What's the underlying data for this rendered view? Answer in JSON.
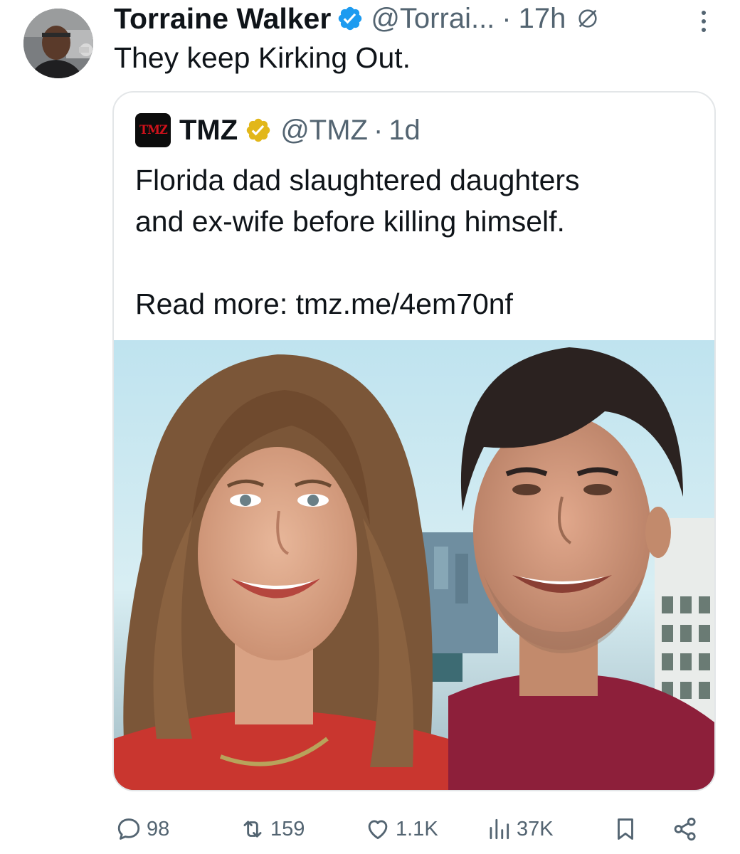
{
  "tweet": {
    "author_name": "Torraine Walker",
    "handle": "@Torrai...",
    "separator": "·",
    "time": "17h",
    "text": "They keep Kirking Out.",
    "icons": {
      "avatar": "avatar-photo",
      "verified": "verified-badge-icon",
      "edited": "edited-icon",
      "more": "more-options-icon"
    }
  },
  "quote": {
    "logo_text": "TMZ",
    "author_name": "TMZ",
    "handle": "@TMZ",
    "separator": "·",
    "time": "1d",
    "text_line1": "Florida dad slaughtered daughters",
    "text_line2": "and ex-wife before killing himself.",
    "text_line3": "Read more: tmz.me/4em70nf"
  },
  "actions": {
    "replies": "98",
    "reposts": "159",
    "likes": "1.1K",
    "views": "37K"
  },
  "colors": {
    "text": "#0f1419",
    "muted": "#536471",
    "verified_blue": "#1d9bf0",
    "verified_gold": "#e2b719",
    "border": "#e3e6e8"
  }
}
